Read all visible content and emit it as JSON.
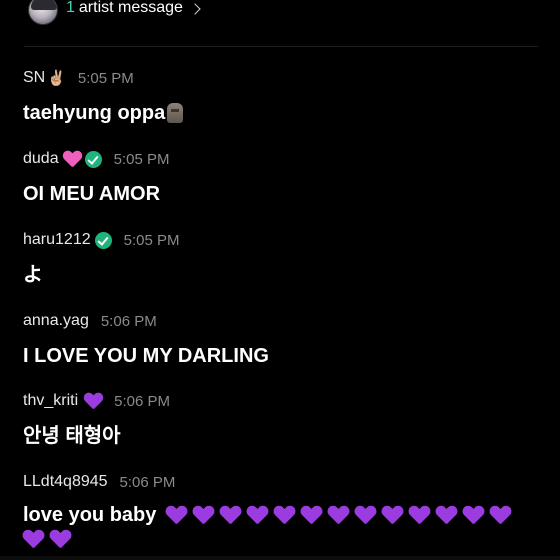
{
  "header": {
    "artist_count": "1",
    "artist_link_label": "artist message"
  },
  "messages": [
    {
      "user": "SN",
      "user_emoji": "✌🏼",
      "time": "5:05 PM",
      "text": "taehyung oppa",
      "text_emoji": "moai"
    },
    {
      "user": "duda",
      "time": "5:05 PM",
      "text": "OI MEU AMOR",
      "badges": [
        "pink-heart",
        "verified"
      ]
    },
    {
      "user": "haru1212",
      "time": "5:05 PM",
      "text": "よ",
      "badges": [
        "verified"
      ]
    },
    {
      "user": "anna.yag",
      "time": "5:06 PM",
      "text": "I LOVE YOU MY DARLING"
    },
    {
      "user": "thv_kriti",
      "time": "5:06 PM",
      "text": "안녕 태형아",
      "badges": [
        "purple-heart"
      ]
    },
    {
      "user": "LLdt4q8945",
      "time": "5:06 PM",
      "text": "love you baby",
      "purple_heart_count": 15
    }
  ],
  "colors": {
    "background": "#000000",
    "accent_count": "#3fd4c0",
    "verified": "#20b37c",
    "purple_heart": "#9b3ce0",
    "pink_heart": "#ef5fbe"
  }
}
